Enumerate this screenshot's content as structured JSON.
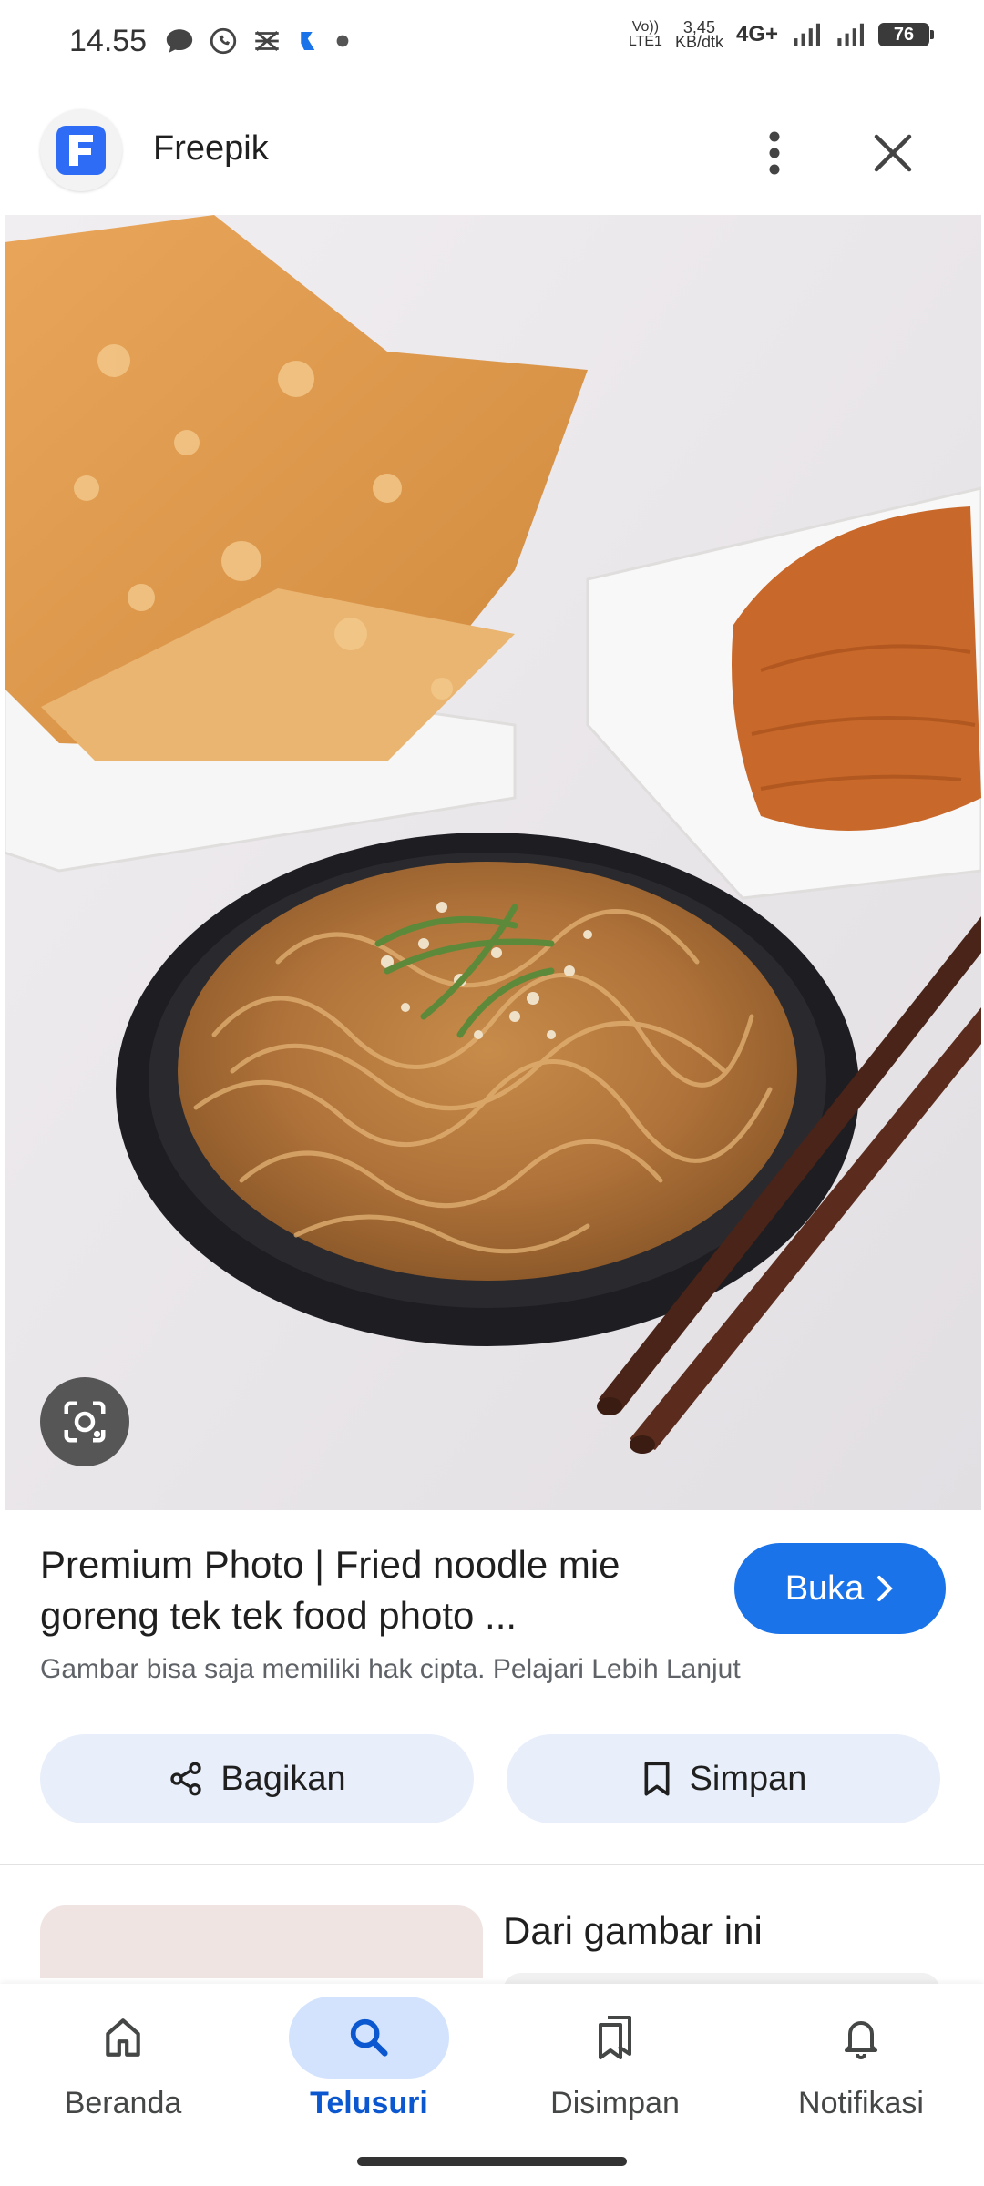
{
  "status_bar": {
    "time": "14.55",
    "volte_top": "Vo))",
    "volte_bottom": "LTE1",
    "speed_top": "3,45",
    "speed_bottom": "KB/dtk",
    "network": "4G+",
    "battery": "76"
  },
  "header": {
    "site_name": "Freepik",
    "logo_letter": "F"
  },
  "result": {
    "title": "Premium Photo | Fried noodle mie goreng tek tek food photo ...",
    "open_label": "Buka",
    "copyright_notice": "Gambar bisa saja memiliki hak cipta. Pelajari Lebih Lanjut"
  },
  "actions": {
    "share_label": "Bagikan",
    "save_label": "Simpan"
  },
  "related": {
    "title": "Dari gambar ini"
  },
  "bottom_nav": {
    "items": [
      {
        "label": "Beranda",
        "icon": "home-icon",
        "active": false
      },
      {
        "label": "Telusuri",
        "icon": "search-icon",
        "active": true
      },
      {
        "label": "Disimpan",
        "icon": "bookmarks-icon",
        "active": false
      },
      {
        "label": "Notifikasi",
        "icon": "bell-icon",
        "active": false
      }
    ]
  },
  "colors": {
    "accent": "#1a73e8",
    "active_nav": "#0b57d0",
    "button_tint": "#e8effa"
  }
}
